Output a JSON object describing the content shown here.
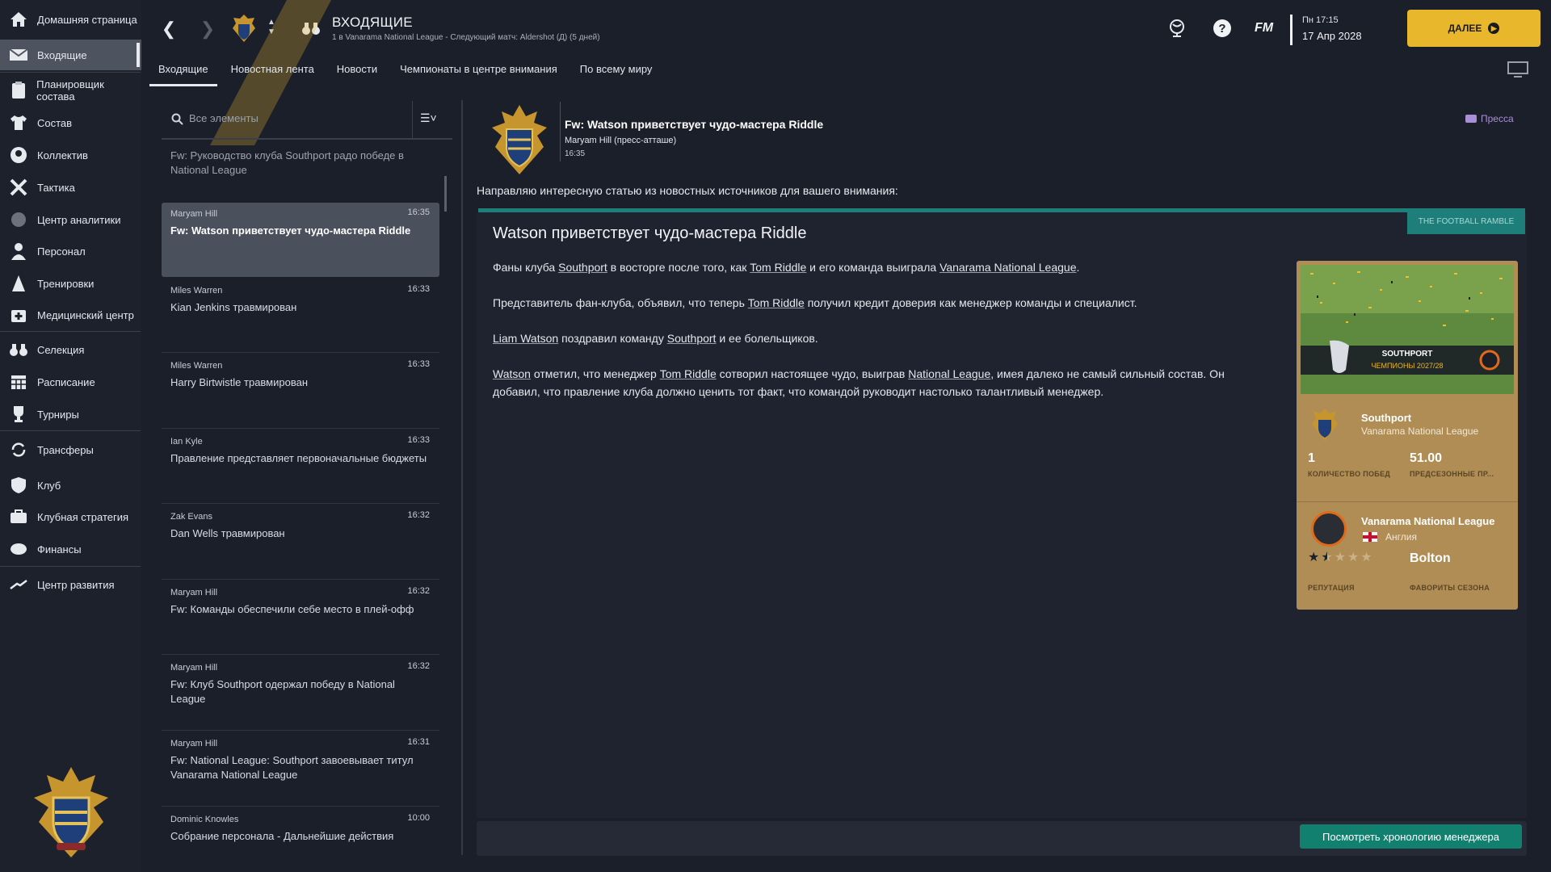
{
  "sidebar": {
    "items": [
      {
        "label": "Домашняя страница",
        "icon": "home-icon"
      },
      {
        "label": "Входящие",
        "icon": "mail-icon"
      },
      {
        "label": "Планировщик состава",
        "icon": "planner-icon"
      },
      {
        "label": "Состав",
        "icon": "shirt-icon"
      },
      {
        "label": "Коллектив",
        "icon": "team-icon"
      },
      {
        "label": "Тактика",
        "icon": "tactics-icon"
      },
      {
        "label": "Центр аналитики",
        "icon": "analytics-icon"
      },
      {
        "label": "Персонал",
        "icon": "staff-icon"
      },
      {
        "label": "Тренировки",
        "icon": "training-icon"
      },
      {
        "label": "Медицинский центр",
        "icon": "medical-icon"
      },
      {
        "label": "Селекция",
        "icon": "binoculars-icon"
      },
      {
        "label": "Расписание",
        "icon": "calendar-icon"
      },
      {
        "label": "Турниры",
        "icon": "trophy-icon"
      },
      {
        "label": "Трансферы",
        "icon": "transfer-icon"
      },
      {
        "label": "Клуб",
        "icon": "shield-icon"
      },
      {
        "label": "Клубная стратегия",
        "icon": "strategy-icon"
      },
      {
        "label": "Финансы",
        "icon": "finance-icon"
      },
      {
        "label": "Центр развития",
        "icon": "development-icon"
      }
    ]
  },
  "header": {
    "title": "ВХОДЯЩИЕ",
    "subtitle": "1 в Vanarama National League - Следующий матч: Aldershot (Д) (5 дней)",
    "brand": "FM",
    "day_time": "Пн 17:15",
    "date": "17 Апр 2028",
    "next_label": "ДАЛЕЕ"
  },
  "tabs": [
    {
      "label": "Входящие"
    },
    {
      "label": "Новостная лента"
    },
    {
      "label": "Новости"
    },
    {
      "label": "Чемпионаты в центре внимания"
    },
    {
      "label": "По всему миру"
    }
  ],
  "search": {
    "placeholder": "Все элементы"
  },
  "messages": [
    {
      "from": "",
      "time": "",
      "subject": "Fw: Руководство клуба Southport радо победе в National League"
    },
    {
      "from": "Maryam Hill",
      "time": "16:35",
      "subject": "Fw: Watson приветствует чудо-мастера Riddle"
    },
    {
      "from": "Miles Warren",
      "time": "16:33",
      "subject": "Kian Jenkins травмирован"
    },
    {
      "from": "Miles Warren",
      "time": "16:33",
      "subject": "Harry Birtwistle травмирован"
    },
    {
      "from": "Ian Kyle",
      "time": "16:33",
      "subject": "Правление представляет первоначальные бюджеты"
    },
    {
      "from": "Zak Evans",
      "time": "16:32",
      "subject": "Dan Wells травмирован"
    },
    {
      "from": "Maryam Hill",
      "time": "16:32",
      "subject": "Fw: Команды обеспечили себе место в плей-офф"
    },
    {
      "from": "Maryam Hill",
      "time": "16:32",
      "subject": "Fw: Клуб Southport одержал победу в National League"
    },
    {
      "from": "Maryam Hill",
      "time": "16:31",
      "subject": "Fw: National League: Southport завоевывает титул Vanarama National League"
    },
    {
      "from": "Dominic Knowles",
      "time": "10:00",
      "subject": "Собрание персонала - Дальнейшие действия"
    }
  ],
  "mail": {
    "title": "Fw: Watson приветствует чудо-мастера Riddle",
    "from": "Maryam Hill  (пресс-атташе)",
    "time": "16:35",
    "tag": "Пресса",
    "intro": "Направляю интересную статью из новостных источников для вашего внимания:"
  },
  "article": {
    "source": "THE FOOTBALL RAMBLE",
    "title": "Watson приветствует чудо-мастера Riddle",
    "p1": [
      "Фаны клуба ",
      "Southport",
      " в восторге после того, как ",
      "Tom Riddle",
      " и его команда выиграла ",
      "Vanarama National League",
      "."
    ],
    "p2": [
      "Представитель фан-клуба, объявил, что теперь ",
      "Tom Riddle",
      " получил кредит доверия как менеджер команды и специалист."
    ],
    "p3": [
      "Liam Watson",
      " поздравил команду ",
      "Southport",
      " и ее болельщиков."
    ],
    "p4": [
      "Watson",
      " отметил, что менеджер ",
      "Tom Riddle",
      " сотворил настоящее чудо, выиграв ",
      "National League",
      ", имея далеко не самый сильный состав. Он добавил, что правление клуба должно ценить тот факт, что командой руководит настолько талантливый менеджер."
    ]
  },
  "card": {
    "banner_club": "SOUTHPORT",
    "banner_text": "ЧЕМПИОНЫ 2027/28",
    "club": "Southport",
    "club_league": "Vanarama National League",
    "wins_value": "1",
    "wins_label": "КОЛИЧЕСТВО ПОБЕД",
    "preseason_value": "51.00",
    "preseason_label": "ПРЕДСЕЗОННЫЕ ПР...",
    "league": "Vanarama National League",
    "country": "Англия",
    "reputation_stars": 1.5,
    "reputation_max": 5,
    "reputation_label": "РЕПУТАЦИЯ",
    "favourite": "Bolton",
    "favourite_label": "ФАВОРИТЫ СЕЗОНА"
  },
  "footer": {
    "timeline_button": "Посмотреть хронологию менеджера"
  },
  "colors": {
    "accent_yellow": "#e8b72b",
    "teal": "#1e7f7a",
    "green_button": "#12806f",
    "card_gold": "#b08d55"
  }
}
